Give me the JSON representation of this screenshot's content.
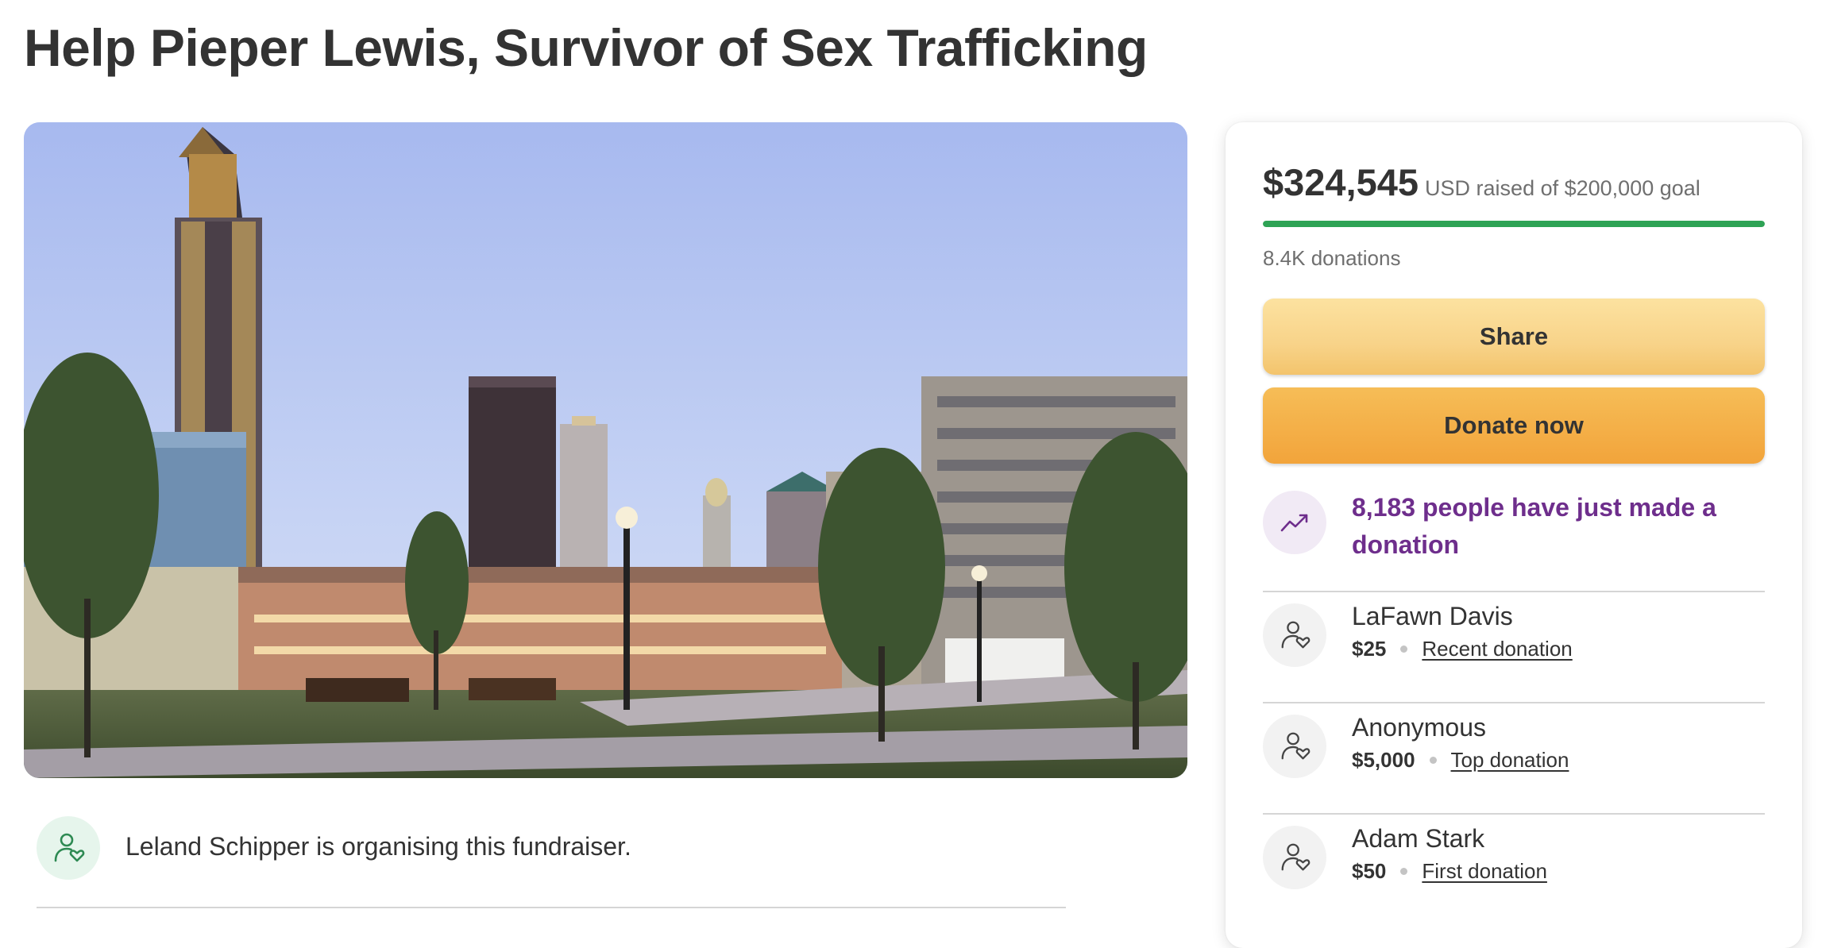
{
  "title": "Help Pieper Lewis, Survivor of Sex Trafficking",
  "hero_image": {
    "alt": "Des Moines skyline with park at dusk"
  },
  "organiser": {
    "text": "Leland Schipper is organising this fundraiser.",
    "icon": "person-heart-icon"
  },
  "fundraiser": {
    "raised_amount": "$324,545",
    "raised_text": "USD raised of $200,000 goal",
    "progress_fraction": 1.0,
    "donations_count": "8.4K donations",
    "share_label": "Share",
    "donate_label": "Donate now",
    "recent_activity": "8,183 people have just made a donation",
    "accent_color": "#2ea355",
    "activity_color": "#6e2e8c"
  },
  "donations": [
    {
      "name": "LaFawn Davis",
      "amount": "$25",
      "type": "Recent donation"
    },
    {
      "name": "Anonymous",
      "amount": "$5,000",
      "type": "Top donation"
    },
    {
      "name": "Adam Stark",
      "amount": "$50",
      "type": "First donation"
    }
  ]
}
